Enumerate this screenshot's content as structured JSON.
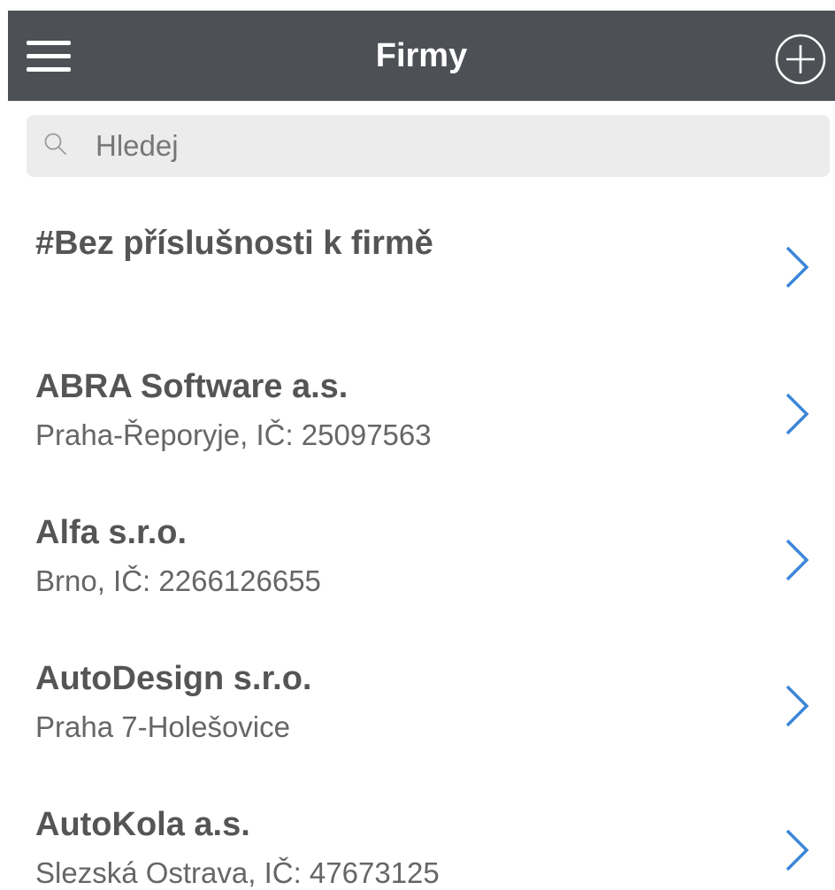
{
  "header": {
    "title": "Firmy",
    "menu_icon": "menu-icon",
    "add_icon": "add-circle-icon"
  },
  "search": {
    "placeholder": "Hledej",
    "value": "",
    "icon": "search-icon"
  },
  "companies": [
    {
      "name": "#Bez příslušnosti k firmě",
      "detail": ""
    },
    {
      "name": "ABRA Software a.s.",
      "detail": "Praha-Řeporyje, IČ: 25097563"
    },
    {
      "name": "Alfa s.r.o.",
      "detail": "Brno, IČ: 2266126655"
    },
    {
      "name": "AutoDesign s.r.o.",
      "detail": "Praha 7-Holešovice"
    },
    {
      "name": "AutoKola a.s.",
      "detail": "Slezská Ostrava, IČ: 47673125"
    }
  ],
  "colors": {
    "appbar": "#4d5055",
    "chevron": "#3a86d8",
    "search_bg": "#ececec",
    "name_text": "#555555",
    "detail_text": "#666666"
  }
}
